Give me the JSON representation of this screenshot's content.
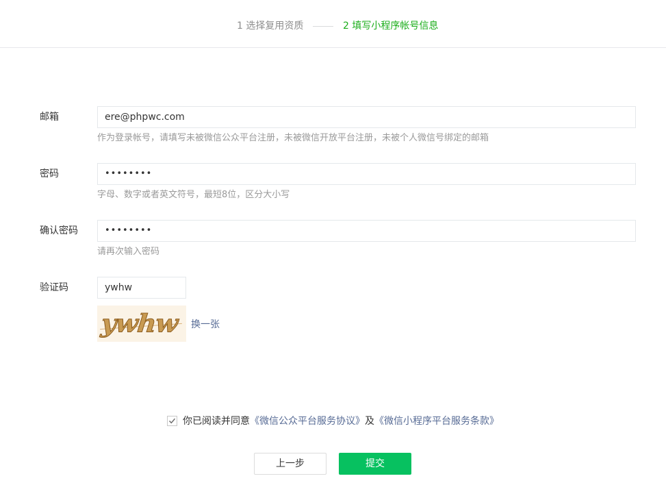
{
  "steps": {
    "step1": "1 选择复用资质",
    "step2": "2 填写小程序帐号信息"
  },
  "form": {
    "email": {
      "label": "邮箱",
      "value": "ere@phpwc.com",
      "tip": "作为登录帐号，请填写未被微信公众平台注册，未被微信开放平台注册，未被个人微信号绑定的邮箱"
    },
    "password": {
      "label": "密码",
      "value": "••••••••",
      "tip": "字母、数字或者英文符号，最短8位，区分大小写"
    },
    "confirm_password": {
      "label": "确认密码",
      "value": "••••••••",
      "tip": "请再次输入密码"
    },
    "captcha": {
      "label": "验证码",
      "value": "ywhw",
      "image_text": "ywhw",
      "refresh_label": "换一张"
    }
  },
  "agreement": {
    "checked": true,
    "prefix": "你已阅读并同意",
    "link1": "《微信公众平台服务协议》",
    "middle": "及",
    "link2": "《微信小程序平台服务条款》"
  },
  "buttons": {
    "prev": "上一步",
    "submit": "提交"
  },
  "colors": {
    "accent": "#1aad19",
    "button_green": "#07c160",
    "link": "#576b95",
    "tip": "#9a9a9a"
  }
}
